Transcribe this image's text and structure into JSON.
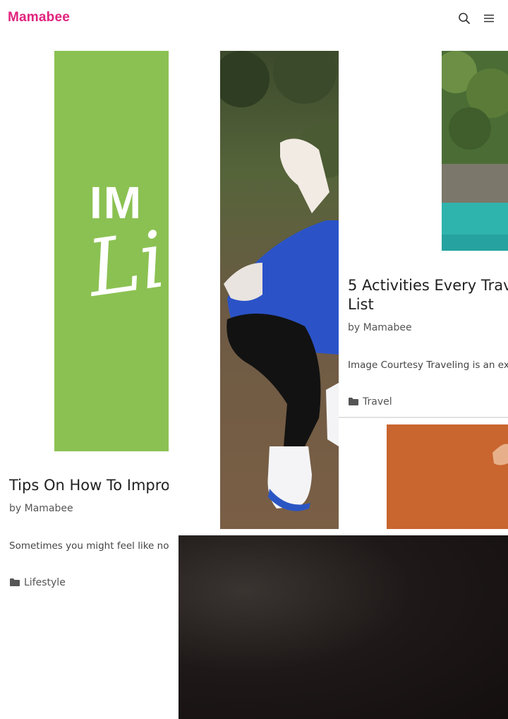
{
  "header": {
    "logo": "Mamabee",
    "icons": [
      "search-icon",
      "menu-icon"
    ]
  },
  "posts": [
    {
      "title": "Tips On How To Impro",
      "author": "by Mamabee",
      "excerpt": "Sometimes you might feel like not",
      "category": "Lifestyle",
      "image_text_line1": "IM",
      "image_text_line2": "Li"
    },
    {
      "title_line1": "5 Activities Every Trav",
      "title_line2": "List",
      "author": "by Mamabee",
      "excerpt": "Image Courtesy Traveling is an ex",
      "category": "Travel"
    }
  ],
  "colors": {
    "brand": "#e0237e",
    "lifestyle_image": "#8bc152",
    "travel_water": "#2fb4ad",
    "orange_image": "#c9652f",
    "dark_image": "#1a1414"
  }
}
